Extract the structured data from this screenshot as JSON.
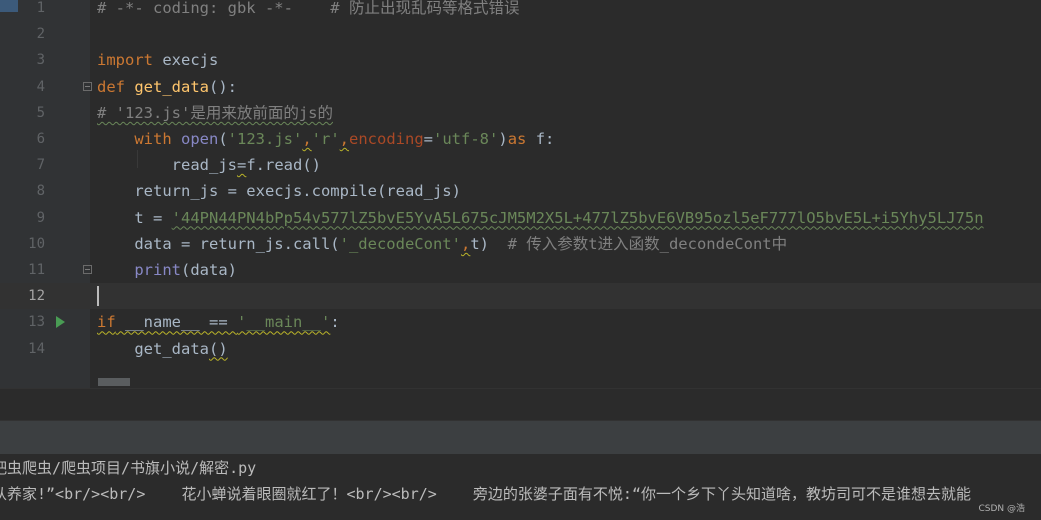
{
  "editor": {
    "current_line": 12,
    "lines": [
      {
        "n": "1",
        "tokens": [
          [
            "c",
            "# -*- coding: gbk -*-    # 防止出现乱码等格式错误"
          ]
        ]
      },
      {
        "n": "2",
        "tokens": []
      },
      {
        "n": "3",
        "tokens": [
          [
            "k",
            "import"
          ],
          [
            "",
            " execjs"
          ]
        ]
      },
      {
        "n": "4",
        "tokens": [
          [
            "k",
            "def "
          ],
          [
            "fn",
            "get_data"
          ],
          [
            "",
            "():"
          ]
        ]
      },
      {
        "n": "5",
        "tokens": [
          [
            "c sq",
            "# '123.js'是用来放前面的js的"
          ]
        ]
      },
      {
        "n": "6",
        "tokens": [
          [
            "",
            "    "
          ],
          [
            "k",
            "with "
          ],
          [
            "b",
            "open"
          ],
          [
            "",
            "("
          ],
          [
            "s",
            "'123.js'"
          ],
          [
            "k sq-w",
            ","
          ],
          [
            "s",
            "'r'"
          ],
          [
            "k sq-w",
            ","
          ],
          [
            "pn",
            "encoding"
          ],
          [
            "",
            "="
          ],
          [
            "s",
            "'utf-8'"
          ],
          [
            "",
            ")"
          ],
          [
            "k",
            "as "
          ],
          [
            "",
            "f:"
          ]
        ]
      },
      {
        "n": "7",
        "tokens": [
          [
            "",
            "        read_js"
          ],
          [
            "sq-w",
            "="
          ],
          [
            "",
            "f.read()"
          ]
        ]
      },
      {
        "n": "8",
        "tokens": [
          [
            "",
            "    return_js = execjs.compile(read_js)"
          ]
        ]
      },
      {
        "n": "9",
        "tokens": [
          [
            "",
            "    t = "
          ],
          [
            "s sq",
            "'44PN44PN4bPp54v577lZ5bvE5YvA5L675cJM5M2X5L+477lZ5bvE6VB95ozl5eF777lO5bvE5L+i5Yhy5LJ75n"
          ]
        ]
      },
      {
        "n": "10",
        "tokens": [
          [
            "",
            "    data = return_js.call("
          ],
          [
            "s",
            "'_decodeCont'"
          ],
          [
            "k sq-w",
            ","
          ],
          [
            "",
            "t)  "
          ],
          [
            "c",
            "# 传入参数t进入函数_decondeCont中"
          ]
        ]
      },
      {
        "n": "11",
        "tokens": [
          [
            "",
            "    "
          ],
          [
            "b",
            "print"
          ],
          [
            "",
            "(data)"
          ]
        ]
      },
      {
        "n": "12",
        "tokens": []
      },
      {
        "n": "13",
        "tokens": [
          [
            "k sq-w",
            "if"
          ],
          [
            "sq-w",
            " __name__ == "
          ],
          [
            "s sq-w",
            "'__main__'"
          ],
          [
            "",
            ":"
          ]
        ]
      },
      {
        "n": "14",
        "tokens": [
          [
            "",
            "    get_data"
          ],
          [
            "sq-w",
            "()"
          ]
        ]
      }
    ]
  },
  "console": {
    "path_line": "吧虫爬虫/爬虫项目/书旗小说/解密.py",
    "output_line": "从养家!”<br/><br/>    花小蝉说着眼圈就红了！<br/><br/>    旁边的张婆子面有不悦:“你一个乡下丫头知道啥，教坊司可不是谁想去就能"
  },
  "watermark": "CSDN @浩"
}
